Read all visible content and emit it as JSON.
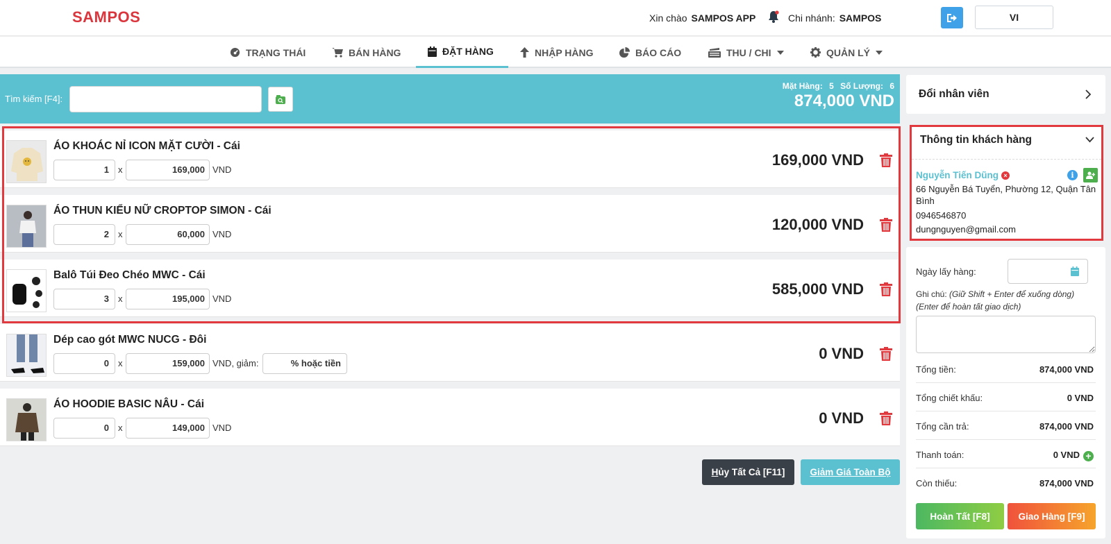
{
  "header": {
    "logo": "SAMPOS",
    "greeting_label": "Xin chào",
    "user_name": "SAMPOS APP",
    "branch_label": "Chi nhánh:",
    "branch_name": "SAMPOS",
    "language": "VI"
  },
  "nav": {
    "items": [
      {
        "label": "TRẠNG THÁI",
        "icon": "dashboard-icon"
      },
      {
        "label": "BÁN HÀNG",
        "icon": "cart-icon"
      },
      {
        "label": "ĐẶT HÀNG",
        "icon": "calendar-icon",
        "active": true
      },
      {
        "label": "NHẬP HÀNG",
        "icon": "arrow-up-icon"
      },
      {
        "label": "BÁO CÁO",
        "icon": "pie-chart-icon"
      },
      {
        "label": "THU / CHI",
        "icon": "cash-register-icon",
        "dropdown": true
      },
      {
        "label": "QUẢN LÝ",
        "icon": "gear-icon",
        "dropdown": true
      }
    ]
  },
  "search": {
    "label": "Tìm kiếm [F4]:",
    "value": "",
    "items_label": "Mặt Hàng:",
    "items_count": "5",
    "qty_label": "Số Lượng:",
    "qty_count": "6",
    "grand_total": "874,000 VND"
  },
  "products": [
    {
      "name": "ÁO KHOÁC NỈ ICON MẶT CƯỜI - Cái",
      "qty": "1",
      "price": "169,000",
      "unit": "VND",
      "total": "169,000 VND"
    },
    {
      "name": "ÁO THUN KIỂU NỮ CROPTOP SIMON - Cái",
      "qty": "2",
      "price": "60,000",
      "unit": "VND",
      "total": "120,000 VND"
    },
    {
      "name": "Balô Túi Đeo Chéo MWC - Cái",
      "qty": "3",
      "price": "195,000",
      "unit": "VND",
      "total": "585,000 VND"
    },
    {
      "name": "Dép cao gót MWC NUCG - Đôi",
      "qty": "0",
      "price": "159,000",
      "unit": "VND, giảm:",
      "discount_placeholder": "% hoặc tiền",
      "total": "0 VND"
    },
    {
      "name": "ÁO HOODIE BASIC NÂU - Cái",
      "qty": "0",
      "price": "149,000",
      "unit": "VND",
      "total": "0 VND"
    }
  ],
  "actions": {
    "cancel_key": "H",
    "cancel_rest": "ủy Tất Cả [F11]",
    "discount_key": "G",
    "discount_rest": "iảm Giá Toàn Bộ"
  },
  "employee": {
    "title": "Đổi nhân viên"
  },
  "customer": {
    "title": "Thông tin khách hàng",
    "name": "Nguyễn Tiến Dũng",
    "address": "66 Nguyễn Bá Tuyển, Phường 12, Quận Tân Bình",
    "phone": "0946546870",
    "email": "dungnguyen@gmail.com"
  },
  "order": {
    "pickup_label": "Ngày lấy hàng:",
    "note_label": "Ghi chú:",
    "note_hint1": "(Giữ Shift + Enter để xuống dòng)",
    "note_hint2": "(Enter để hoàn tất giao dịch)",
    "summary": [
      {
        "label": "Tổng tiền:",
        "value": "874,000 VND"
      },
      {
        "label": "Tổng chiết khấu:",
        "value": "0 VND"
      },
      {
        "label": "Tổng cần trả:",
        "value": "874,000 VND"
      },
      {
        "label": "Thanh toán:",
        "value": "0 VND",
        "add": true
      },
      {
        "label": "Còn thiếu:",
        "value": "874,000 VND"
      }
    ],
    "finish_label": "Hoàn Tất [F8]",
    "ship_label": "Giao Hàng [F9]"
  },
  "colors": {
    "brand": "#d9363e",
    "accent": "#5bc0d0",
    "danger": "#e2393f",
    "success": "#4cae4c"
  }
}
